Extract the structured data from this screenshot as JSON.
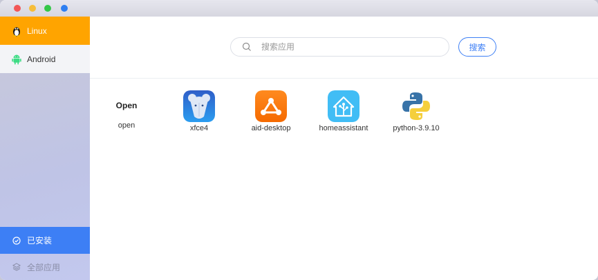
{
  "window": {
    "controls": [
      "close-dot",
      "minimize-dot",
      "maximize-dot",
      "extra-dot"
    ]
  },
  "sidebar": {
    "top_items": [
      {
        "label": "Linux",
        "icon": "penguin-icon",
        "active": true
      },
      {
        "label": "Android",
        "icon": "android-icon",
        "active": false
      }
    ],
    "bottom_items": [
      {
        "label": "已安装",
        "icon": "check-circle-icon",
        "active": true
      },
      {
        "label": "全部应用",
        "icon": "layers-icon",
        "active": false
      }
    ]
  },
  "search": {
    "placeholder": "搜索应用",
    "value": "",
    "button_label": "搜索"
  },
  "apps": {
    "open_title": "Open",
    "open_label": "open",
    "items": [
      {
        "name": "xfce4",
        "icon": "xfce-mouse-icon"
      },
      {
        "name": "aid-desktop",
        "icon": "aid-desktop-icon"
      },
      {
        "name": "homeassistant",
        "icon": "home-assistant-icon"
      },
      {
        "name": "python-3.9.10",
        "icon": "python-icon"
      }
    ]
  },
  "colors": {
    "accent_orange": "#ffa400",
    "accent_blue": "#3d7ff5"
  }
}
